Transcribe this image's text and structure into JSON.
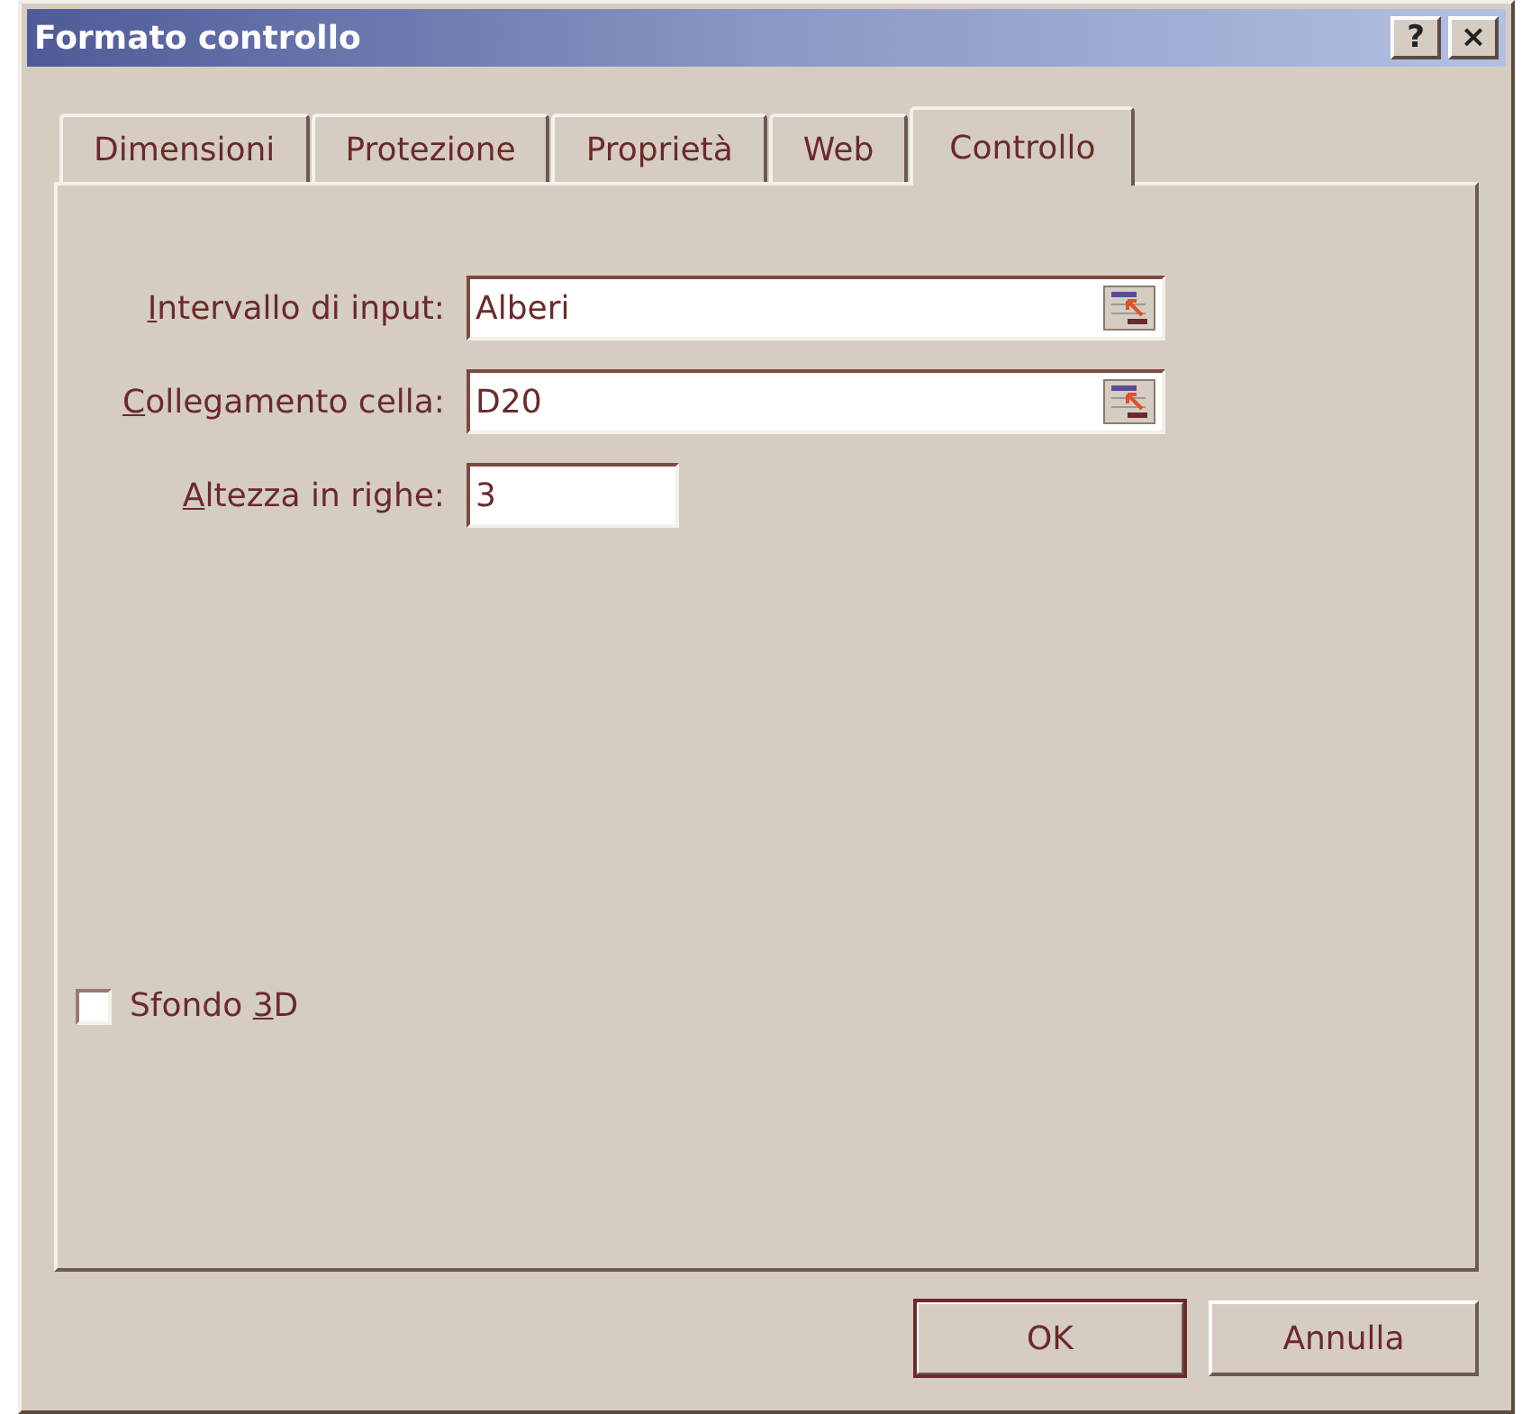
{
  "window": {
    "title": "Formato controllo",
    "help_button": "?",
    "close_button": "×"
  },
  "tabs": [
    {
      "label": "Dimensioni",
      "selected": false
    },
    {
      "label": "Protezione",
      "selected": false
    },
    {
      "label": "Proprietà",
      "selected": false
    },
    {
      "label": "Web",
      "selected": false
    },
    {
      "label": "Controllo",
      "selected": true
    }
  ],
  "fields": [
    {
      "label": [
        {
          "text": "I",
          "underline": true
        },
        {
          "text": "ntervallo di input:",
          "underline": false
        }
      ],
      "value": "Alberi",
      "kind": "range"
    },
    {
      "label": [
        {
          "text": "C",
          "underline": true
        },
        {
          "text": "ollegamento cella:",
          "underline": false
        }
      ],
      "value": "D20",
      "kind": "range"
    },
    {
      "label": [
        {
          "text": "A",
          "underline": true
        },
        {
          "text": "ltezza in righe:",
          "underline": false
        }
      ],
      "value": "3",
      "kind": "short"
    }
  ],
  "checkbox": {
    "label": [
      {
        "text": "Sfondo ",
        "underline": false
      },
      {
        "text": "3",
        "underline": true
      },
      {
        "text": "D",
        "underline": false
      }
    ],
    "checked": false
  },
  "buttons": [
    {
      "label": "OK",
      "default": true
    },
    {
      "label": "Annulla",
      "default": false
    }
  ]
}
